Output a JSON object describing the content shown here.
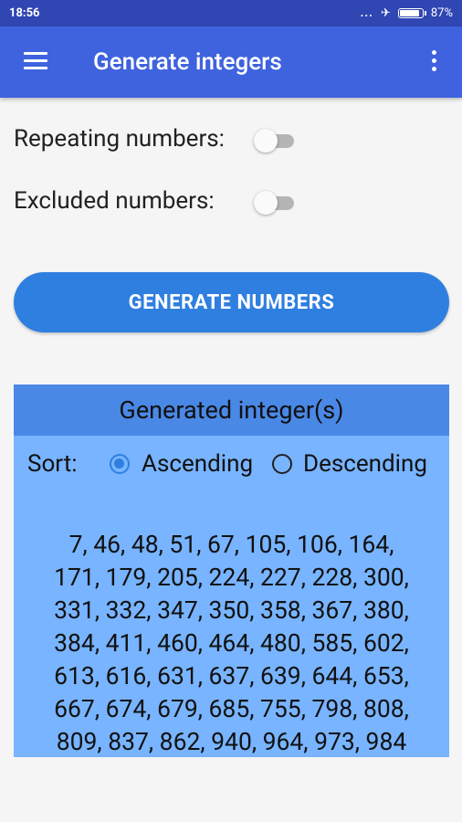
{
  "status_bar": {
    "time": "18:56",
    "dots": "...",
    "airplane": "✈",
    "battery": "87%"
  },
  "app_bar": {
    "title": "Generate integers"
  },
  "options": {
    "repeating_label": "Repeating numbers:",
    "excluded_label": "Excluded numbers:",
    "repeating_on": false,
    "excluded_on": false
  },
  "generate_label": "GENERATE NUMBERS",
  "result": {
    "header": "Generated integer(s)",
    "sort_label": "Sort:",
    "ascending_label": "Ascending",
    "descending_label": "Descending",
    "selected_sort": "Ascending",
    "numbers_lines": [
      "7, 46, 48, 51, 67, 105, 106, 164,",
      "171, 179, 205, 224, 227, 228, 300,",
      "331, 332, 347, 350, 358, 367, 380,",
      "384, 411, 460, 464, 480, 585, 602,",
      "613, 616, 631, 637, 639, 644, 653,",
      "667, 674, 679, 685, 755, 798, 808,",
      "809, 837, 862, 940, 964, 973, 984"
    ]
  },
  "colors": {
    "status_bar": "#2f46b3",
    "app_bar": "#3f63de",
    "button": "#2f7fe0",
    "panel": "#78b4ff",
    "panel_header": "#4a88e6"
  }
}
